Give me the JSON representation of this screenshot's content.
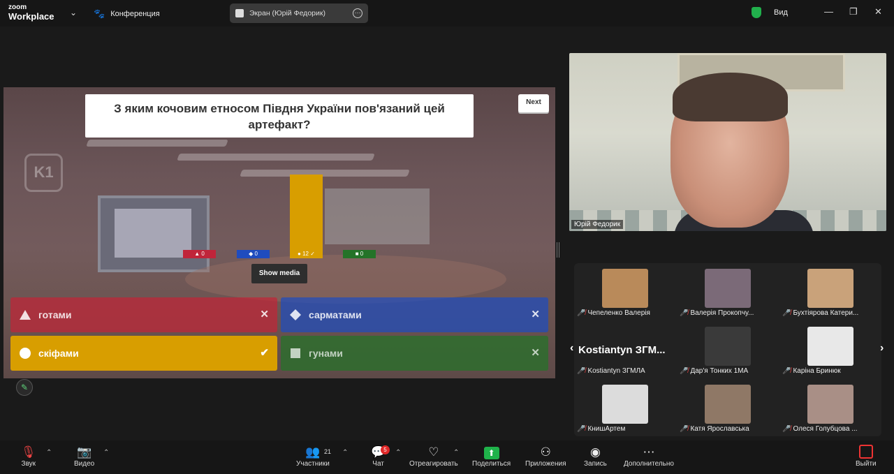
{
  "topbar": {
    "logo_small": "zoom",
    "logo_main": "Workplace",
    "meeting_title": "Конференция",
    "share_title": "Экран (Юрій Федорик)",
    "view_label": "Вид"
  },
  "quiz": {
    "question": "З яким кочовим етносом Півдня України пов'язаний цей артефакт?",
    "next_label": "Next",
    "show_media_label": "Show media",
    "results": [
      {
        "shape": "triangle",
        "label": "▲ 0",
        "count": 0,
        "color": "#c0253a"
      },
      {
        "shape": "diamond",
        "label": "◆ 0",
        "count": 0,
        "color": "#1f4cbe"
      },
      {
        "shape": "circle",
        "label": "● 12 ✓",
        "count": 12,
        "color": "#d89e00"
      },
      {
        "shape": "square",
        "label": "■ 0",
        "count": 0,
        "color": "#247328"
      }
    ],
    "answers": [
      {
        "text": "готами",
        "correct": false,
        "mark": "✕"
      },
      {
        "text": "сарматами",
        "correct": false,
        "mark": "✕"
      },
      {
        "text": "скіфами",
        "correct": true,
        "mark": "✔"
      },
      {
        "text": "гунами",
        "correct": false,
        "mark": "✕"
      }
    ]
  },
  "speaker": {
    "name": "Юрій Федорик"
  },
  "gallery": {
    "featured_name": "Kostiantyn  ЗГМ...",
    "participants": [
      {
        "name": "Чепеленко Валерія",
        "thumb": "#b98a5a"
      },
      {
        "name": "Валерія Прокопчу...",
        "thumb": "#7b6a78"
      },
      {
        "name": "Бухтіярова Катери...",
        "thumb": "#c9a27a"
      },
      {
        "name": "Kostiantyn ЗГМЛА",
        "thumb": ""
      },
      {
        "name": "Дар'я Тонких 1МА",
        "thumb": "#3a3a3a"
      },
      {
        "name": "Каріна Бринюк",
        "thumb": "#e8e8e8"
      },
      {
        "name": "КнишАртем",
        "thumb": "#dcdcdc"
      },
      {
        "name": "Катя Ярославська",
        "thumb": "#8f7866"
      },
      {
        "name": "Олеся Голубцова ...",
        "thumb": "#a98f86"
      }
    ]
  },
  "toolbar": {
    "audio": "Звук",
    "video": "Видео",
    "participants": "Участники",
    "participants_count": "21",
    "chat": "Чат",
    "chat_badge": "5",
    "react": "Отреагировать",
    "share": "Поделиться",
    "apps": "Приложения",
    "record": "Запись",
    "more": "Дополнительно",
    "leave": "Выйти"
  }
}
